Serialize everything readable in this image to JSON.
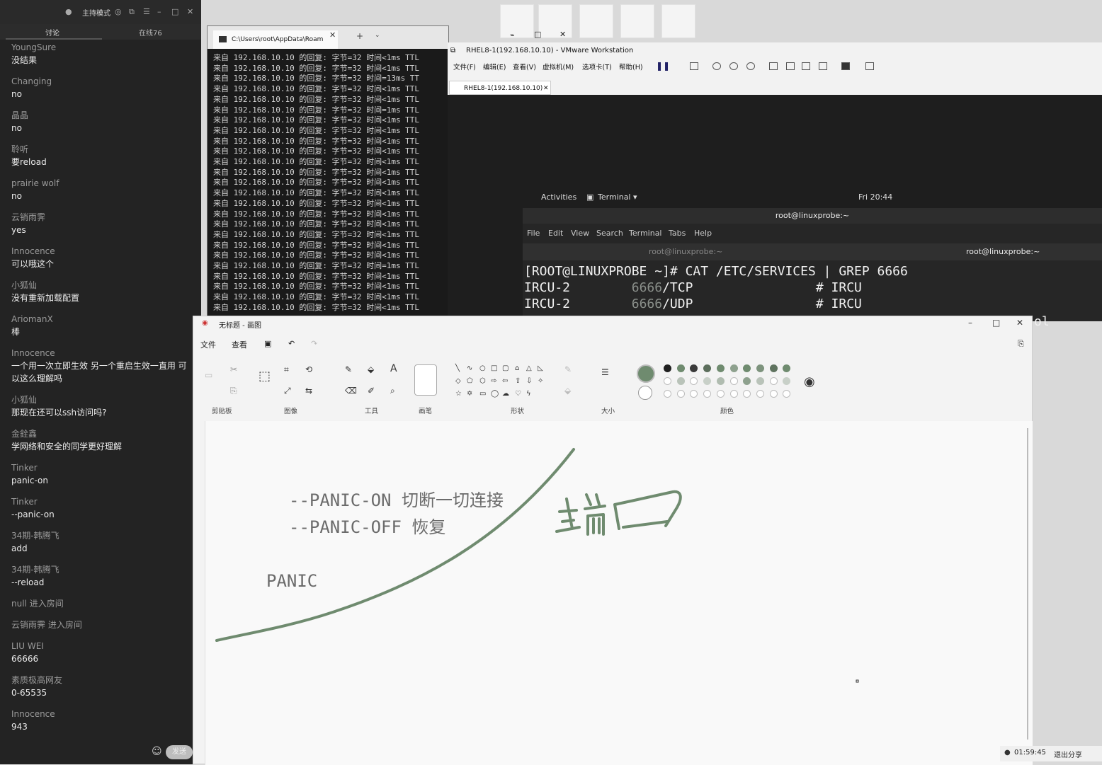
{
  "chat": {
    "mode_label": "主持模式",
    "tabs": [
      "讨论",
      "在线76"
    ],
    "messages": [
      {
        "user": "YoungSure",
        "text": "没结果"
      },
      {
        "user": "Changing",
        "text": "no"
      },
      {
        "user": "晶晶",
        "text": "no"
      },
      {
        "user": "聆听",
        "text": "要reload"
      },
      {
        "user": "prairie wolf",
        "text": "no"
      },
      {
        "user": "云销雨霁",
        "text": "yes"
      },
      {
        "user": "Innocence",
        "text": "可以哦这个"
      },
      {
        "user": "小狐仙",
        "text": "没有重新加载配置"
      },
      {
        "user": "AriomanX",
        "text": "棒"
      },
      {
        "user": "Innocence",
        "text": "一个用一次立即生效 另一个重启生效一直用 可以这么理解吗"
      },
      {
        "user": "小狐仙",
        "text": "那现在还可以ssh访问吗?"
      },
      {
        "user": "金銓鑫",
        "text": "学网络和安全的同学更好理解"
      },
      {
        "user": "Tinker",
        "text": "panic-on"
      },
      {
        "user": "Tinker",
        "text": "--panic-on"
      },
      {
        "user": "34期-韩腾飞",
        "text": "add"
      },
      {
        "user": "34期-韩腾飞",
        "text": "--reload"
      }
    ],
    "system_events": [
      {
        "user": "null",
        "text": "进入房间"
      },
      {
        "user": "云销雨霁",
        "text": "进入房间"
      }
    ],
    "messages2": [
      {
        "user": "LIU WEI",
        "text": "66666"
      },
      {
        "user": "素质极高网友",
        "text": "0-65535"
      },
      {
        "user": "Innocence",
        "text": "943"
      }
    ],
    "send_label": "发送"
  },
  "cmd": {
    "tab_title": "C:\\Users\\root\\AppData\\Roam",
    "lines": [
      "来自 192.168.10.10 的回复: 字节=32 时间<1ms TTL",
      "来自 192.168.10.10 的回复: 字节=32 时间<1ms TTL",
      "来自 192.168.10.10 的回复: 字节=32 时间=13ms TT",
      "来自 192.168.10.10 的回复: 字节=32 时间<1ms TTL",
      "来自 192.168.10.10 的回复: 字节=32 时间<1ms TTL",
      "来自 192.168.10.10 的回复: 字节=32 时间=1ms TTL",
      "来自 192.168.10.10 的回复: 字节=32 时间<1ms TTL",
      "来自 192.168.10.10 的回复: 字节=32 时间<1ms TTL",
      "来自 192.168.10.10 的回复: 字节=32 时间<1ms TTL",
      "来自 192.168.10.10 的回复: 字节=32 时间<1ms TTL",
      "来自 192.168.10.10 的回复: 字节=32 时间<1ms TTL",
      "来自 192.168.10.10 的回复: 字节=32 时间<1ms TTL",
      "来自 192.168.10.10 的回复: 字节=32 时间<1ms TTL",
      "来自 192.168.10.10 的回复: 字节=32 时间<1ms TTL",
      "来自 192.168.10.10 的回复: 字节=32 时间<1ms TTL",
      "来自 192.168.10.10 的回复: 字节=32 时间<1ms TTL",
      "来自 192.168.10.10 的回复: 字节=32 时间<1ms TTL",
      "来自 192.168.10.10 的回复: 字节=32 时间<1ms TTL",
      "来自 192.168.10.10 的回复: 字节=32 时间<1ms TTL",
      "来自 192.168.10.10 的回复: 字节=32 时间<1ms TTL",
      "来自 192.168.10.10 的回复: 字节=32 时间=1ms TTL",
      "来自 192.168.10.10 的回复: 字节=32 时间<1ms TTL",
      "来自 192.168.10.10 的回复: 字节=32 时间<1ms TTL",
      "来自 192.168.10.10 的回复: 字节=32 时间<1ms TTL",
      "来自 192.168.10.10 的回复: 字节=32 时间<1ms TTL"
    ]
  },
  "vmware": {
    "title": "RHEL8-1(192.168.10.10) - VMware Workstation",
    "menu": [
      "文件(F)",
      "编辑(E)",
      "查看(V)",
      "虚拟机(M)",
      "选项卡(T)",
      "帮助(H)"
    ],
    "vm_tab": "RHEL8-1(192.168.10.10)"
  },
  "guest": {
    "activities": "Activities",
    "terminal_app": "Terminal ▾",
    "clock": "Fri 20:44",
    "term_title": "root@linuxprobe:~",
    "term_menu": [
      "File",
      "Edit",
      "View",
      "Search",
      "Terminal",
      "Tabs",
      "Help"
    ],
    "term_tabs": [
      "root@linuxprobe:~",
      "root@linuxprobe:~"
    ],
    "prompt_line": "[ROOT@LINUXPROBE ~]# CAT /ETC/SERVICES | GREP 6666",
    "out1_name": "IRCU-2",
    "out1_port": "6666",
    "out1_proto": "/TCP",
    "out1_comment": "# IRCU",
    "out2_name": "IRCU-2",
    "out2_port": "6666",
    "out2_proto": "/UDP",
    "out2_comment": "# IRCU",
    "trailing": "OL"
  },
  "paint": {
    "title": "无标题 - 画图",
    "menu": [
      "文件",
      "查看"
    ],
    "groups": [
      "剪贴板",
      "图像",
      "工具",
      "画笔",
      "形状",
      "大小",
      "颜色"
    ],
    "canvas_text": {
      "line1": "--PANIC-ON 切断一切连接",
      "line2": "--PANIC-OFF 恢复",
      "line3": "PANIC"
    },
    "handwriting": "端口",
    "ink_color": "#6f8b6f"
  },
  "status": {
    "time": "01:59:45",
    "exit_share": "退出分享"
  }
}
